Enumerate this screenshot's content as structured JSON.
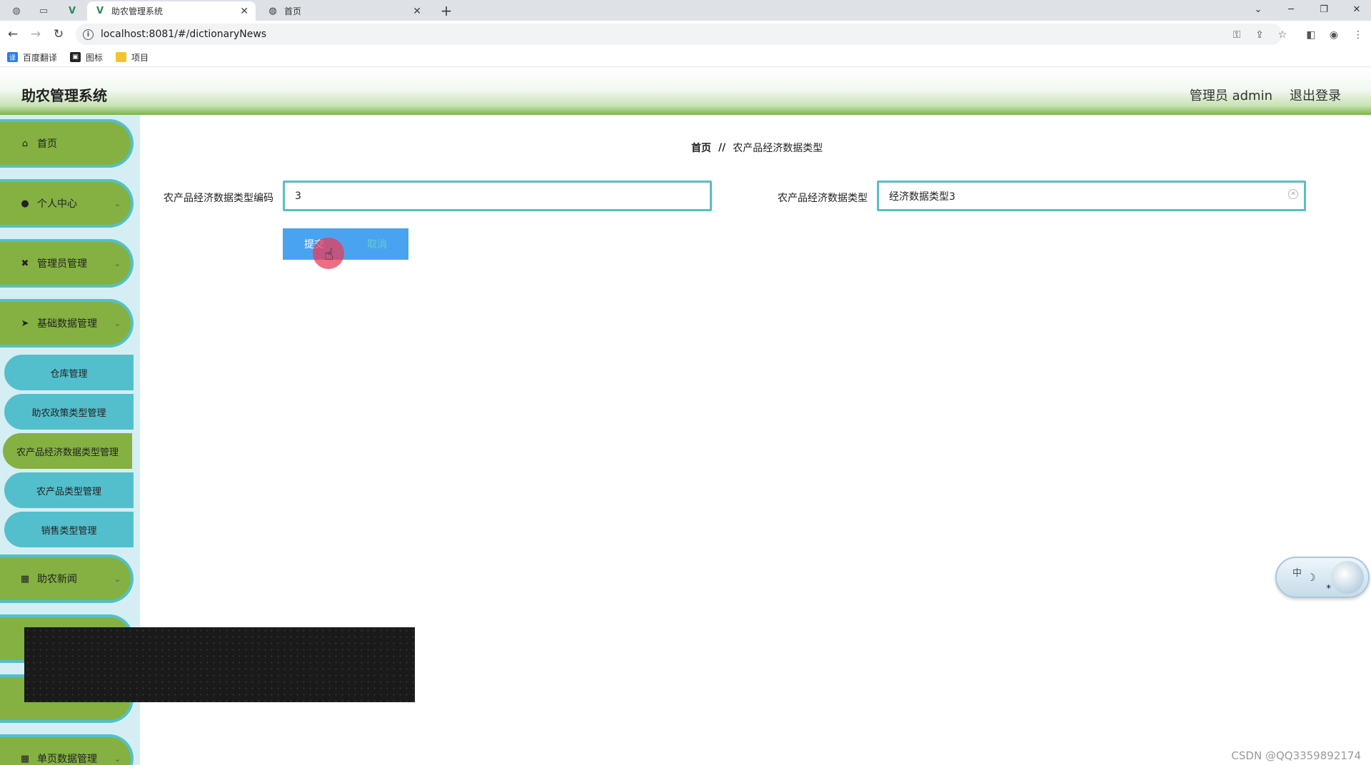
{
  "browser": {
    "tabs": [
      {
        "title": "助农管理系统",
        "active": true,
        "icon": "vue-logo-icon"
      },
      {
        "title": "首页",
        "active": false,
        "icon": "globe-icon"
      }
    ],
    "url": "localhost:8081/#/dictionaryNews",
    "bookmarks": [
      {
        "label": "百度翻译",
        "icon": "translate-icon",
        "color": "#2b7de9"
      },
      {
        "label": "图标",
        "icon": "image-icon",
        "color": "#222222"
      },
      {
        "label": "项目",
        "icon": "folder-icon",
        "color": "#f4c430"
      }
    ]
  },
  "header": {
    "title": "助农管理系统",
    "user": "管理员 admin",
    "logout": "退出登录"
  },
  "sidebar": {
    "items": [
      {
        "label": "首页",
        "icon": "home-icon",
        "glyph": "⌂",
        "arrow": ""
      },
      {
        "label": "个人中心",
        "icon": "user-icon",
        "glyph": "●",
        "arrow": "⌄"
      },
      {
        "label": "管理员管理",
        "icon": "admin-icon",
        "glyph": "✖",
        "arrow": "⌄"
      },
      {
        "label": "基础数据管理",
        "icon": "send-icon",
        "glyph": "➤",
        "arrow": "⌄"
      },
      {
        "label": "助农新闻",
        "icon": "grid-icon",
        "glyph": "▦",
        "arrow": "⌄"
      },
      {
        "label": "单页数据管理",
        "icon": "grid-icon",
        "glyph": "▦",
        "arrow": "⌄"
      }
    ],
    "sub_items": [
      {
        "label": "仓库管理",
        "active": false
      },
      {
        "label": "助农政策类型管理",
        "active": false
      },
      {
        "label": "农产品经济数据类型管理",
        "active": true
      },
      {
        "label": "农产品类型管理",
        "active": false
      },
      {
        "label": "销售类型管理",
        "active": false
      }
    ]
  },
  "breadcrumb": {
    "home": "首页",
    "separator": "//",
    "current": "农产品经济数据类型"
  },
  "form": {
    "code_label": "农产品经济数据类型编码",
    "code_value": "3",
    "type_label": "农产品经济数据类型",
    "type_value": "经济数据类型3",
    "submit_label": "提交",
    "cancel_label": "取消"
  },
  "widget": {
    "char": "中"
  },
  "watermark": "CSDN @QQ3359892174",
  "colors": {
    "sidebar_item": "#84b142",
    "sidebar_border": "#54c0c8",
    "sub_item": "#54bfcc",
    "button": "#4aa3f1",
    "input_border": "#54c0c8"
  }
}
